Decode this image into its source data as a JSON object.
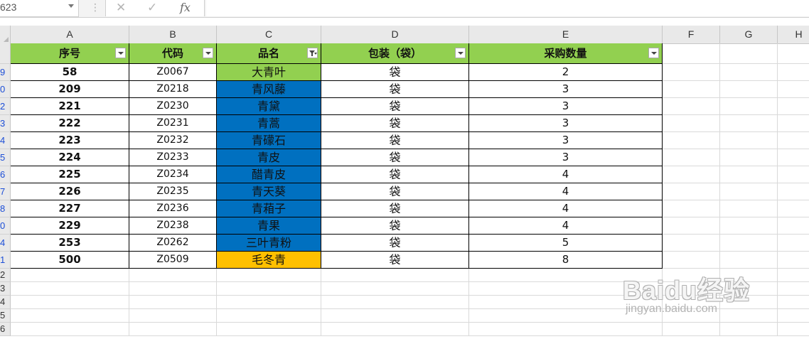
{
  "formula_bar": {
    "name_box": "623",
    "separator": "⋮",
    "cancel_icon": "✕",
    "enter_icon": "✓",
    "fx_label": "fx",
    "formula": ""
  },
  "columns": [
    "A",
    "B",
    "C",
    "D",
    "E",
    "F",
    "G",
    "H"
  ],
  "table": {
    "headers": [
      "序号",
      "代码",
      "品名",
      "包装（袋）",
      "采购数量"
    ],
    "filtered_column_index": 2,
    "rows": [
      {
        "row_label": "9",
        "cells": [
          "58",
          "Z0067",
          "大青叶",
          "袋",
          "2"
        ],
        "name_fill": "#92d050"
      },
      {
        "row_label": "0",
        "cells": [
          "209",
          "Z0218",
          "青风藤",
          "袋",
          "3"
        ],
        "name_fill": "#0070c0"
      },
      {
        "row_label": "2",
        "cells": [
          "221",
          "Z0230",
          "青黛",
          "袋",
          "3"
        ],
        "name_fill": "#0070c0"
      },
      {
        "row_label": "3",
        "cells": [
          "222",
          "Z0231",
          "青蒿",
          "袋",
          "3"
        ],
        "name_fill": "#0070c0"
      },
      {
        "row_label": "4",
        "cells": [
          "223",
          "Z0232",
          "青礞石",
          "袋",
          "3"
        ],
        "name_fill": "#0070c0"
      },
      {
        "row_label": "5",
        "cells": [
          "224",
          "Z0233",
          "青皮",
          "袋",
          "3"
        ],
        "name_fill": "#0070c0"
      },
      {
        "row_label": "6",
        "cells": [
          "225",
          "Z0234",
          "醋青皮",
          "袋",
          "4"
        ],
        "name_fill": "#0070c0"
      },
      {
        "row_label": "7",
        "cells": [
          "226",
          "Z0235",
          "青天葵",
          "袋",
          "4"
        ],
        "name_fill": "#0070c0"
      },
      {
        "row_label": "8",
        "cells": [
          "227",
          "Z0236",
          "青葙子",
          "袋",
          "4"
        ],
        "name_fill": "#0070c0"
      },
      {
        "row_label": "0",
        "cells": [
          "229",
          "Z0238",
          "青果",
          "袋",
          "4"
        ],
        "name_fill": "#0070c0"
      },
      {
        "row_label": "4",
        "cells": [
          "253",
          "Z0262",
          "三叶青粉",
          "袋",
          "5"
        ],
        "name_fill": "#0070c0"
      },
      {
        "row_label": "1",
        "cells": [
          "500",
          "Z0509",
          "毛冬青",
          "袋",
          "8"
        ],
        "name_fill": "#ffc000"
      }
    ]
  },
  "empty_row_labels": [
    "2",
    "3",
    "4",
    "5",
    "6"
  ],
  "colors": {
    "header_fill": "#92d050",
    "filtered_row_number": "#1d4fd7"
  },
  "watermark": {
    "logo_text": "Baidu经验",
    "url": "jingyan.baidu.com"
  }
}
